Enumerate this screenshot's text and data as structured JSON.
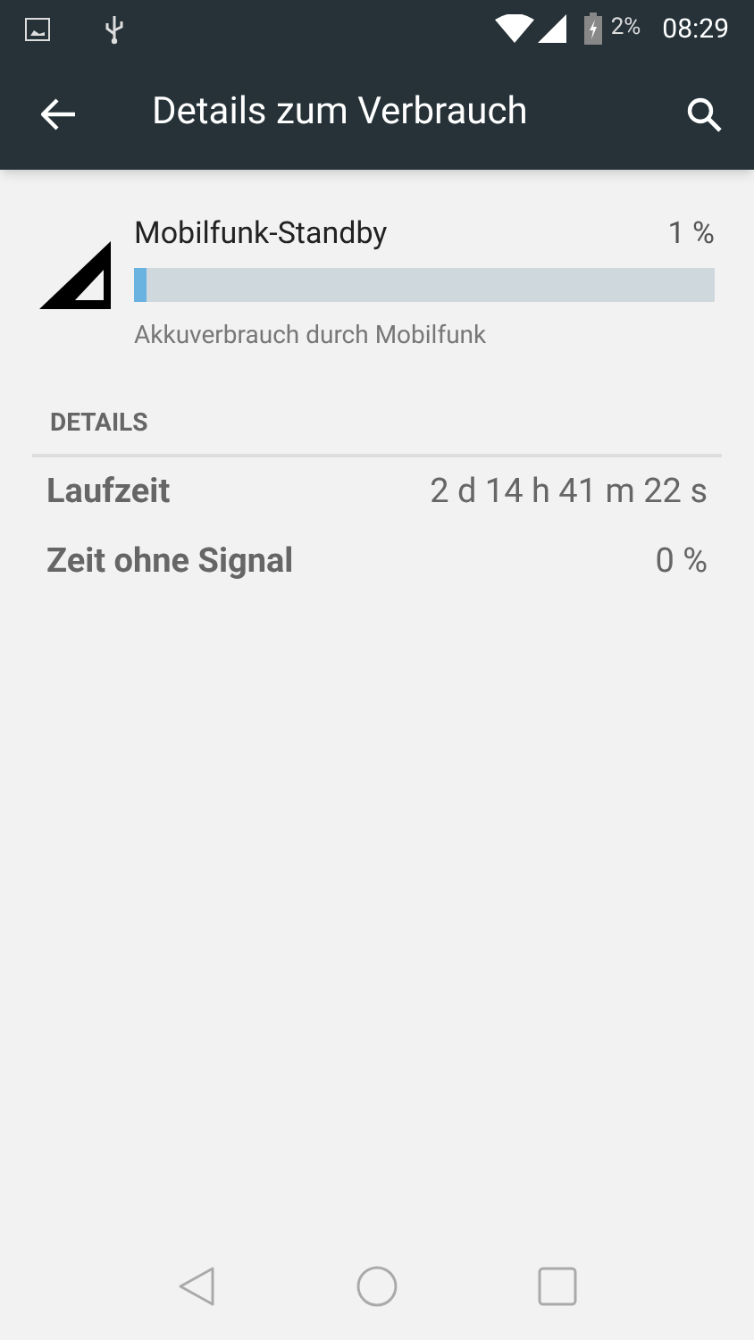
{
  "status_bar": {
    "battery_percent": "2%",
    "time": "08:29"
  },
  "toolbar": {
    "title": "Details zum Verbrauch"
  },
  "usage": {
    "title": "Mobilfunk-Standby",
    "percent": "1 %",
    "level": 0.02,
    "subtitle": "Akkuverbrauch durch Mobilfunk"
  },
  "details": {
    "header": "DETAILS",
    "rows": [
      {
        "label": "Laufzeit",
        "value": "2 d 14 h 41 m 22 s"
      },
      {
        "label": "Zeit ohne Signal",
        "value": "0 %"
      }
    ]
  }
}
